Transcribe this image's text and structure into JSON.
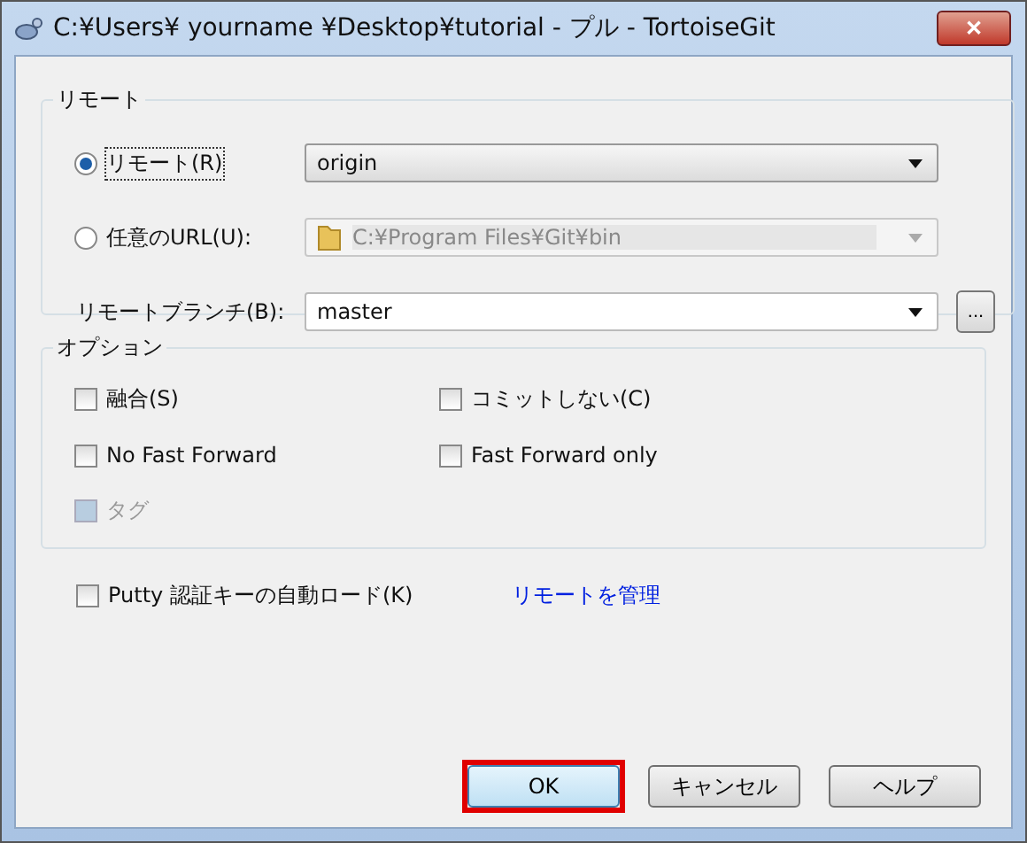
{
  "window": {
    "title": "C:¥Users¥ yourname ¥Desktop¥tutorial - プル - TortoiseGit",
    "close": "✕"
  },
  "remote_group": {
    "title": "リモート",
    "sources": [
      {
        "kind": "combo",
        "label": "リモート(R)",
        "selected": true,
        "value": "origin",
        "disabled": false
      },
      {
        "kind": "path",
        "label": "任意のURL(U):",
        "selected": false,
        "value": "C:¥Program Files¥Git¥bin",
        "disabled": true
      }
    ],
    "branch": {
      "label": "リモートブランチ(B):",
      "value": "master",
      "browse": "..."
    }
  },
  "options_group": {
    "title": "オプション",
    "checkboxes": [
      {
        "label": "融合(S)",
        "checked": false,
        "disabled": false
      },
      {
        "label": "コミットしない(C)",
        "checked": false,
        "disabled": false
      },
      {
        "label": "No Fast Forward",
        "checked": false,
        "disabled": false
      },
      {
        "label": "Fast Forward only",
        "checked": false,
        "disabled": false
      },
      {
        "label": "タグ",
        "checked": false,
        "disabled": true
      }
    ]
  },
  "putty": {
    "label": "Putty 認証キーの自動ロード(K)",
    "checked": false
  },
  "manage_link": "リモートを管理",
  "buttons": [
    {
      "label": "OK",
      "highlighted": true
    },
    {
      "label": "キャンセル",
      "highlighted": false
    },
    {
      "label": "ヘルプ",
      "highlighted": false
    }
  ]
}
